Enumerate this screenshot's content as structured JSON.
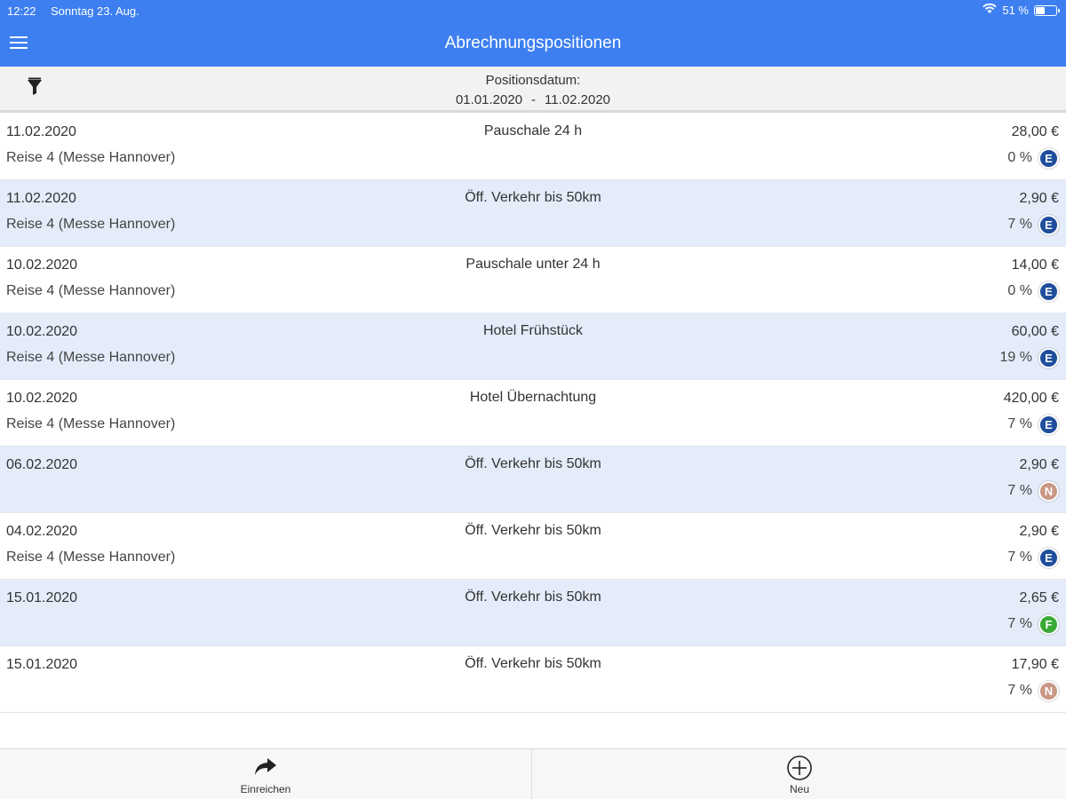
{
  "status_bar": {
    "time": "12:22",
    "date": "Sonntag 23. Aug.",
    "battery": "51 %",
    "battery_level": 0.51,
    "icons": [
      "wifi-icon",
      "battery-icon"
    ]
  },
  "header": {
    "title": "Abrechnungspositionen",
    "menu_icon": "hamburger-icon",
    "color": "#3d7ff0"
  },
  "filter": {
    "icon": "filter-icon",
    "label": "Positionsdatum:",
    "from": "01.01.2020",
    "separator": "-",
    "to": "11.02.2020"
  },
  "badge_colors": {
    "E": "#1f4e9c",
    "N": "#c99783",
    "F": "#3aaa35"
  },
  "rows": [
    {
      "date": "11.02.2020",
      "trip": "Reise 4 (Messe Hannover)",
      "type": "Pauschale 24 h",
      "amount": "28,00 €",
      "vat": "0 %",
      "badge": "E"
    },
    {
      "date": "11.02.2020",
      "trip": "Reise 4 (Messe Hannover)",
      "type": "Öff. Verkehr bis 50km",
      "amount": "2,90 €",
      "vat": "7 %",
      "badge": "E"
    },
    {
      "date": "10.02.2020",
      "trip": "Reise 4 (Messe Hannover)",
      "type": "Pauschale unter 24 h",
      "amount": "14,00 €",
      "vat": "0 %",
      "badge": "E"
    },
    {
      "date": "10.02.2020",
      "trip": "Reise 4 (Messe Hannover)",
      "type": "Hotel Frühstück",
      "amount": "60,00 €",
      "vat": "19 %",
      "badge": "E"
    },
    {
      "date": "10.02.2020",
      "trip": "Reise 4 (Messe Hannover)",
      "type": "Hotel Übernachtung",
      "amount": "420,00 €",
      "vat": "7 %",
      "badge": "E"
    },
    {
      "date": "06.02.2020",
      "trip": "",
      "type": "Öff. Verkehr bis 50km",
      "amount": "2,90 €",
      "vat": "7 %",
      "badge": "N"
    },
    {
      "date": "04.02.2020",
      "trip": "Reise 4 (Messe Hannover)",
      "type": "Öff. Verkehr bis 50km",
      "amount": "2,90 €",
      "vat": "7 %",
      "badge": "E"
    },
    {
      "date": "15.01.2020",
      "trip": "",
      "type": "Öff. Verkehr bis 50km",
      "amount": "2,65 €",
      "vat": "7 %",
      "badge": "F"
    },
    {
      "date": "15.01.2020",
      "trip": "",
      "type": "Öff. Verkehr bis 50km",
      "amount": "17,90 €",
      "vat": "7 %",
      "badge": "N"
    }
  ],
  "tabbar": {
    "submit_label": "Einreichen",
    "submit_icon": "share-forward-icon",
    "new_label": "Neu",
    "new_icon": "plus-circle-icon"
  }
}
